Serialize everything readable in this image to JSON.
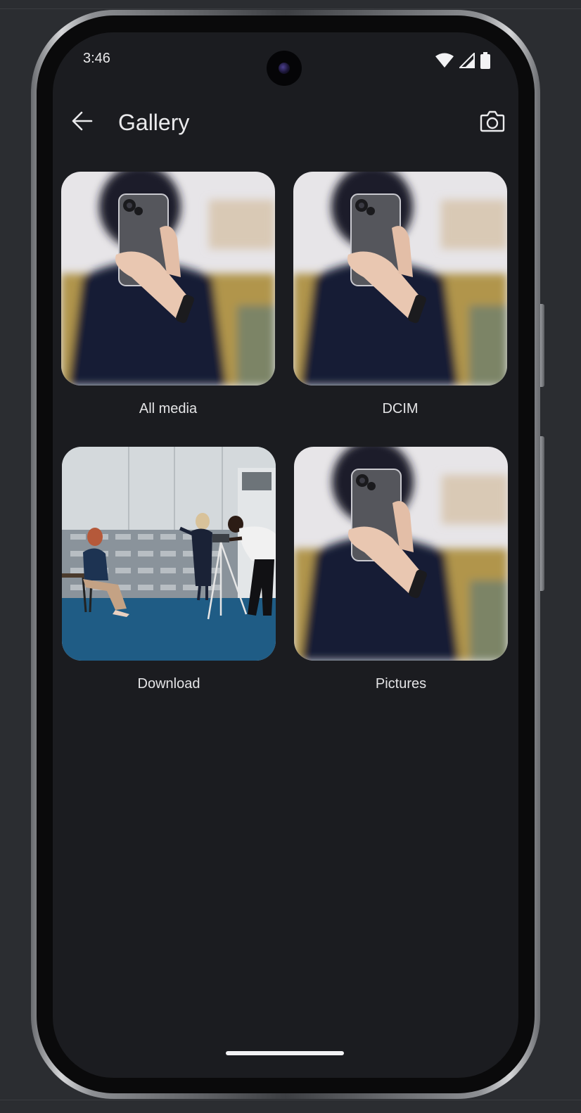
{
  "status_bar": {
    "time": "3:46",
    "icons": [
      "wifi-icon",
      "signal-icon",
      "battery-icon"
    ]
  },
  "app_bar": {
    "title": "Gallery",
    "back_icon": "arrow-back-icon",
    "camera_icon": "camera-icon"
  },
  "albums": [
    {
      "label": "All media",
      "thumbnail": "selfie-phone-photo"
    },
    {
      "label": "DCIM",
      "thumbnail": "selfie-phone-photo"
    },
    {
      "label": "Download",
      "thumbnail": "office-camera-scene-photo"
    },
    {
      "label": "Pictures",
      "thumbnail": "selfie-phone-photo"
    }
  ],
  "colors": {
    "screen_background": "#1b1c20",
    "text_primary": "#eaeaec",
    "outer_background": "#2b2d31"
  }
}
